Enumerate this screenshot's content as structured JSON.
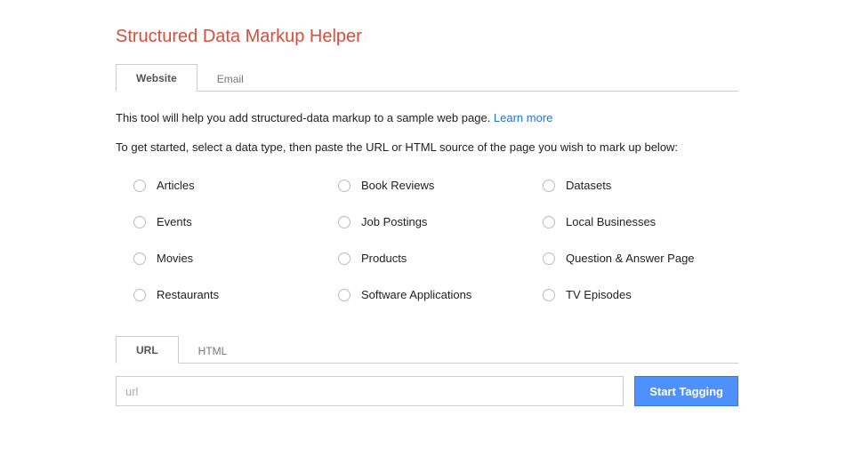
{
  "title": "Structured Data Markup Helper",
  "tabs": {
    "website": "Website",
    "email": "Email"
  },
  "intro_text": "This tool will help you add structured-data markup to a sample web page. ",
  "learn_more": "Learn more",
  "instructions": "To get started, select a data type, then paste the URL or HTML source of the page you wish to mark up below:",
  "data_types": {
    "articles": "Articles",
    "book_reviews": "Book Reviews",
    "datasets": "Datasets",
    "events": "Events",
    "job_postings": "Job Postings",
    "local_businesses": "Local Businesses",
    "movies": "Movies",
    "products": "Products",
    "qa_page": "Question & Answer Page",
    "restaurants": "Restaurants",
    "software_applications": "Software Applications",
    "tv_episodes": "TV Episodes"
  },
  "source_tabs": {
    "url": "URL",
    "html": "HTML"
  },
  "url_input": {
    "placeholder": "url",
    "value": ""
  },
  "start_button": "Start Tagging"
}
